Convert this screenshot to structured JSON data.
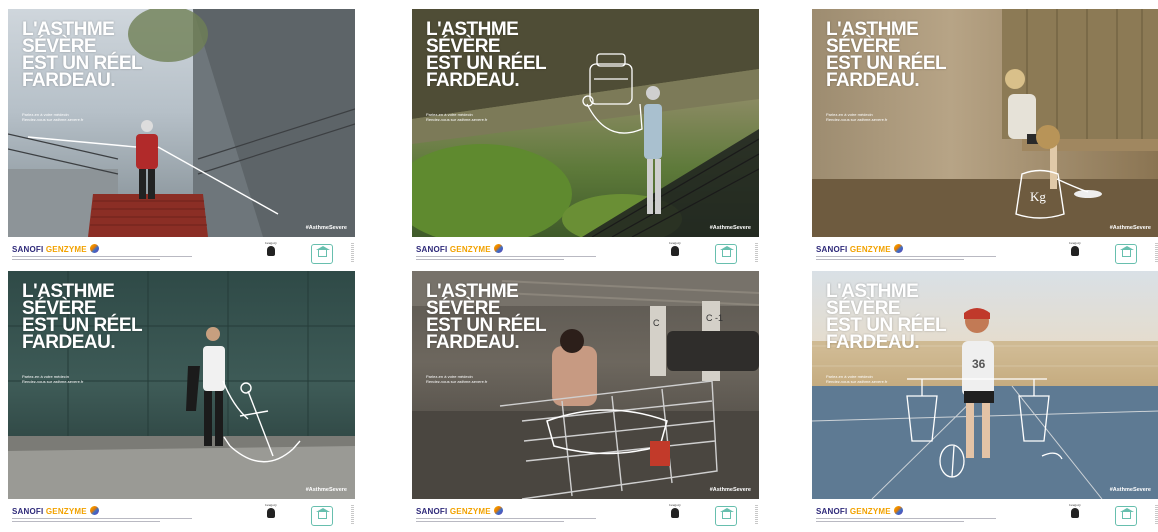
{
  "posters": [
    {
      "headline": "L'ASTHME\nSÉVÈRE\nEST UN RÉEL\nFARDEAU.",
      "sub1": "Parlez-en à votre médecin",
      "sub2": "Rendez-vous sur asthme-severe.fr",
      "hashtag": "#AsthmeSevere"
    },
    {
      "headline": "L'ASTHME\nSÉVÈRE\nEST UN RÉEL\nFARDEAU.",
      "sub1": "Parlez-en à votre médecin",
      "sub2": "Rendez-vous sur asthme-severe.fr",
      "hashtag": "#AsthmeSevere"
    },
    {
      "headline": "L'ASTHME\nSÉVÈRE\nEST UN RÉEL\nFARDEAU.",
      "sub1": "Parlez-en à votre médecin",
      "sub2": "Rendez-vous sur asthme-severe.fr",
      "hashtag": "#AsthmeSevere",
      "weight_label": "Kg"
    },
    {
      "headline": "L'ASTHME\nSÉVÈRE\nEST UN RÉEL\nFARDEAU.",
      "sub1": "Partez-en à votre médecin",
      "sub2": "Rendez-vous sur asthme-severe.fr",
      "hashtag": "#AsthmeSevere"
    },
    {
      "headline": "L'ASTHME\nSÉVÈRE\nEST UN RÉEL\nFARDEAU.",
      "sub1": "Parlez-en à votre médecin",
      "sub2": "Rendez-vous sur asthme-severe.fr",
      "hashtag": "#AsthmeSevere",
      "pillar_c": "C",
      "pillar_c1": "C\n-1"
    },
    {
      "headline": "L'ASTHME\nSÉVÈRE\nEST UN RÉEL\nFARDEAU.",
      "sub1": "Parlez-en à votre médecin",
      "sub2": "Rendez-vous sur asthme-severe.fr",
      "hashtag": "#AsthmeSevere",
      "jersey_number": "36"
    }
  ],
  "footer": {
    "brand_sanofi": "SANOFI",
    "brand_genzyme": "GENZYME",
    "partner1_line1": "Gregory",
    "partner1_line2": "Pariente",
    "partner1_line3": "Fondation"
  },
  "colors": {
    "sanofi_blue": "#2f2a7a",
    "genzyme_orange": "#f2a200",
    "partner_teal": "#67bfae"
  }
}
